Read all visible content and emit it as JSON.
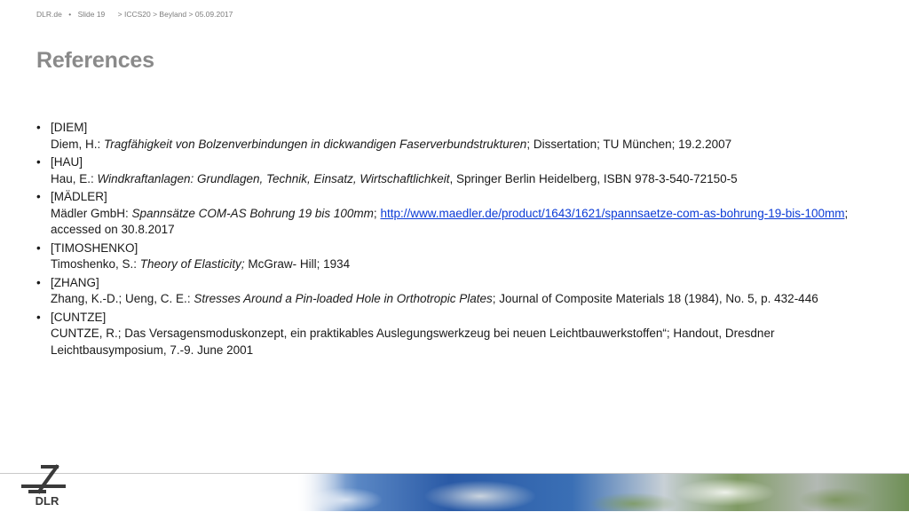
{
  "header": {
    "site": "DLR.de",
    "slide": "Slide 19",
    "breadcrumb": "> ICCS20 > Beyland > 05.09.2017"
  },
  "title": "References",
  "references": [
    {
      "key": "[DIEM]",
      "author": "Diem, H.: ",
      "work": "Tragfähigkeit von Bolzenverbindungen in dickwandigen Faserverbundstrukturen",
      "details": "; Dissertation; TU München; 19.2.2007"
    },
    {
      "key": "[HAU]",
      "author": "Hau, E.: ",
      "work": "Windkraftanlagen: Grundlagen, Technik, Einsatz, Wirtschaftlichkeit",
      "details": ", Springer Berlin Heidelberg, ISBN 978-3-540-72150-5"
    },
    {
      "key": "[MÄDLER]",
      "author": "Mädler GmbH: ",
      "work": "Spannsätze COM-AS Bohrung 19 bis 100mm",
      "sep": "; ",
      "link": "http://www.maedler.de/product/1643/1621/spannsaetze-com-as-bohrung-19-bis-100mm",
      "details": "; accessed on 30.8.2017"
    },
    {
      "key": "[TIMOSHENKO]",
      "author": "Timoshenko, S.: ",
      "work": "Theory of Elasticity;",
      "details": " McGraw- Hill; 1934"
    },
    {
      "key": "[ZHANG]",
      "author": "Zhang, K.-D.; Ueng, C. E.: ",
      "work": "Stresses Around a Pin-loaded Hole in Orthotropic Plates",
      "details": "; Journal of Composite Materials 18 (1984), No. 5, p. 432-446"
    },
    {
      "key": "[CUNTZE]",
      "author": "",
      "work": "",
      "details": "CUNTZE, R.; Das Versagensmoduskonzept, ein praktikables Auslegungswerkzeug bei neuen Leichtbauwerkstoffen“; Handout, Dresdner Leichtbausymposium, 7.-9. June 2001"
    }
  ],
  "logo": {
    "text": "DLR",
    "icon": "dlr-logo-icon"
  },
  "colors": {
    "title": "#8a8a8a",
    "link": "#0b3bd6",
    "header": "#7d7d7d",
    "logo": "#3a3a3a"
  }
}
